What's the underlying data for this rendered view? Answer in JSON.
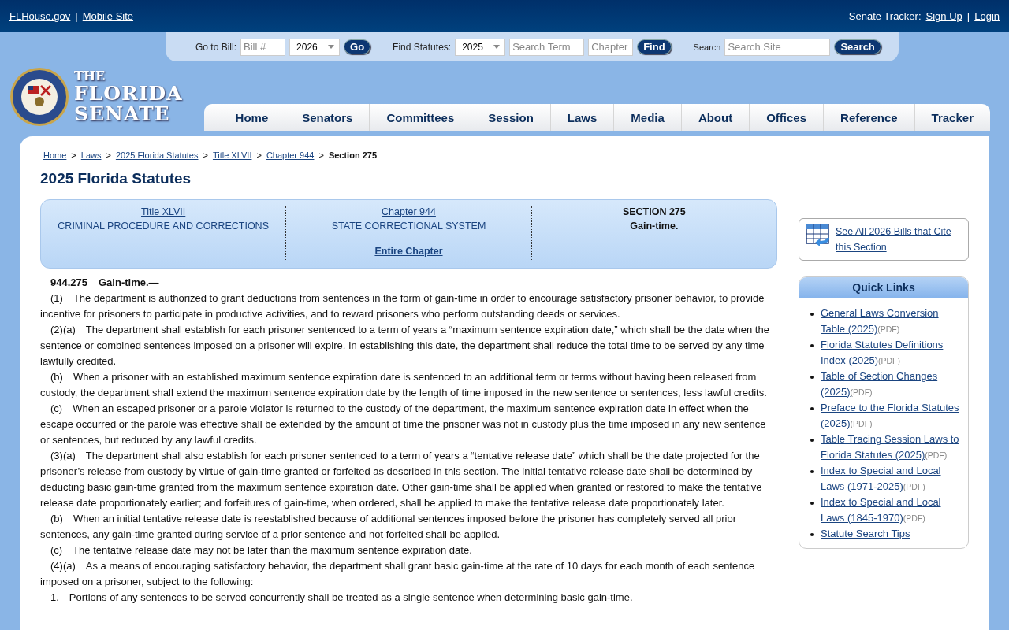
{
  "top_bar": {
    "separator": "|",
    "left_links": [
      "FLHouse.gov",
      "Mobile Site"
    ],
    "tracker_label": "Senate Tracker:",
    "right_links": [
      "Sign Up",
      "Login"
    ]
  },
  "search_strip": {
    "bill_label": "Go to Bill:",
    "bill_placeholder": "Bill #",
    "bill_year": "2026",
    "go_button": "Go",
    "statutes_label": "Find Statutes:",
    "statutes_year": "2025",
    "term_placeholder": "Search Term",
    "chapter_placeholder": "Chapter",
    "find_button": "Find",
    "site_label": "Search",
    "site_placeholder": "Search Site",
    "search_button": "Search"
  },
  "logo": {
    "the": "THE",
    "line1": "FLORIDA",
    "line2": "SENATE"
  },
  "nav": [
    "Home",
    "Senators",
    "Committees",
    "Session",
    "Laws",
    "Media",
    "About",
    "Offices",
    "Reference",
    "Tracker"
  ],
  "breadcrumb": {
    "links": [
      "Home",
      "Laws",
      "2025 Florida Statutes",
      "Title XLVII",
      "Chapter 944"
    ],
    "current": "Section 275",
    "separator": ">"
  },
  "page_title": "2025 Florida Statutes",
  "header_box": {
    "title_link": "Title XLVII",
    "title_name": "CRIMINAL PROCEDURE AND CORRECTIONS",
    "chapter_link": "Chapter 944",
    "chapter_name": "STATE CORRECTIONAL SYSTEM",
    "entire_chapter": "Entire Chapter",
    "section_number": "SECTION 275",
    "section_name": "Gain-time."
  },
  "statute": {
    "number": "944.275",
    "catchline": "Gain-time.—",
    "paragraphs": [
      {
        "num": "(1)",
        "text": "The department is authorized to grant deductions from sentences in the form of gain-time in order to encourage satisfactory prisoner behavior, to provide incentive for prisoners to participate in productive activities, and to reward prisoners who perform outstanding deeds or services."
      },
      {
        "num": "(2)(a)",
        "text": "The department shall establish for each prisoner sentenced to a term of years a “maximum sentence expiration date,” which shall be the date when the sentence or combined sentences imposed on a prisoner will expire. In establishing this date, the department shall reduce the total time to be served by any time lawfully credited."
      },
      {
        "num": "(b)",
        "text": "When a prisoner with an established maximum sentence expiration date is sentenced to an additional term or terms without having been released from custody, the department shall extend the maximum sentence expiration date by the length of time imposed in the new sentence or sentences, less lawful credits."
      },
      {
        "num": "(c)",
        "text": "When an escaped prisoner or a parole violator is returned to the custody of the department, the maximum sentence expiration date in effect when the escape occurred or the parole was effective shall be extended by the amount of time the prisoner was not in custody plus the time imposed in any new sentence or sentences, but reduced by any lawful credits."
      },
      {
        "num": "(3)(a)",
        "text": "The department shall also establish for each prisoner sentenced to a term of years a “tentative release date” which shall be the date projected for the prisoner’s release from custody by virtue of gain-time granted or forfeited as described in this section. The initial tentative release date shall be determined by deducting basic gain-time granted from the maximum sentence expiration date. Other gain-time shall be applied when granted or restored to make the tentative release date proportionately earlier; and forfeitures of gain-time, when ordered, shall be applied to make the tentative release date proportionately later."
      },
      {
        "num": "(b)",
        "text": "When an initial tentative release date is reestablished because of additional sentences imposed before the prisoner has completely served all prior sentences, any gain-time granted during service of a prior sentence and not forfeited shall be applied."
      },
      {
        "num": "(c)",
        "text": "The tentative release date may not be later than the maximum sentence expiration date."
      },
      {
        "num": "(4)(a)",
        "text": "As a means of encouraging satisfactory behavior, the department shall grant basic gain-time at the rate of 10 days for each month of each sentence imposed on a prisoner, subject to the following:"
      },
      {
        "num": "1.",
        "text": "Portions of any sentences to be served concurrently shall be treated as a single sentence when determining basic gain-time."
      }
    ]
  },
  "cite_link": "See All 2026 Bills that Cite this Section",
  "quick_links": {
    "title": "Quick Links",
    "items": [
      {
        "text": "General Laws Conversion Table (2025)",
        "note": "(PDF)"
      },
      {
        "text": "Florida Statutes Definitions Index (2025)",
        "note": "(PDF)"
      },
      {
        "text": "Table of Section Changes (2025)",
        "note": "(PDF)"
      },
      {
        "text": "Preface to the Florida Statutes (2025)",
        "note": "(PDF)"
      },
      {
        "text": "Table Tracing Session Laws to Florida Statutes (2025)",
        "note": "(PDF)"
      },
      {
        "text": "Index to Special and Local Laws (1971-2025)",
        "note": "(PDF)"
      },
      {
        "text": "Index to Special and Local Laws (1845-1970)",
        "note": "(PDF)"
      },
      {
        "text": "Statute Search Tips"
      }
    ]
  }
}
